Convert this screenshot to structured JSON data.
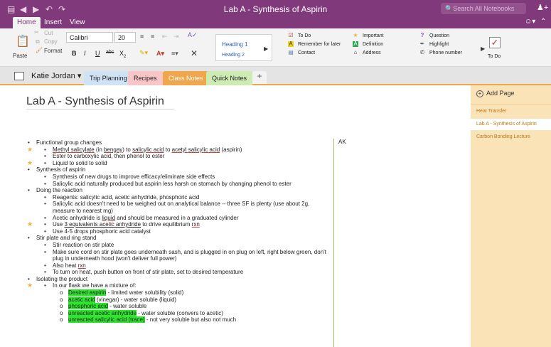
{
  "window": {
    "title": "Lab A - Synthesis of Aspirin",
    "search_placeholder": "Search All Notebooks"
  },
  "ribbon_tabs": [
    "Home",
    "Insert",
    "View"
  ],
  "ribbon": {
    "paste": "Paste",
    "cut": "Cut",
    "copy": "Copy",
    "format": "Format",
    "font_name": "Calibri",
    "font_size": "20",
    "bold": "B",
    "italic": "I",
    "underline": "U",
    "strikethrough": "abc",
    "subscript": "X",
    "styles": [
      "Heading 1",
      "Heading 2"
    ],
    "tags": [
      {
        "label": "To Do",
        "icon": "checkbox-icon",
        "color": "#c0392b"
      },
      {
        "label": "Remember for later",
        "icon": "highlight-a-icon",
        "color": "#f3d21a"
      },
      {
        "label": "Contact",
        "icon": "contact-icon",
        "color": "#5a7fb5"
      },
      {
        "label": "Important",
        "icon": "star-icon",
        "color": "#f0b23a"
      },
      {
        "label": "Definition",
        "icon": "definition-a-icon",
        "color": "#2ea44f"
      },
      {
        "label": "Address",
        "icon": "home-icon",
        "color": "#444444"
      },
      {
        "label": "Question",
        "icon": "question-icon",
        "color": "#8a4ec2"
      },
      {
        "label": "Highlight",
        "icon": "pen-icon",
        "color": "#555555"
      },
      {
        "label": "Phone number",
        "icon": "phone-icon",
        "color": "#444444"
      }
    ],
    "todo_button": "To Do"
  },
  "notebook": {
    "name": "Katie Jordan",
    "sections": [
      {
        "label": "Trip Planning",
        "color": "#cfe3f5"
      },
      {
        "label": "Recipes",
        "color": "#f8c6c6"
      },
      {
        "label": "Class Notes",
        "color": "#f0a64a",
        "active": true
      },
      {
        "label": "Quick Notes",
        "color": "#cdebb2"
      }
    ]
  },
  "page": {
    "title": "Lab A - Synthesis of Aspirin",
    "side_note": "AK",
    "n1": "Functional group changes",
    "n2a": "Methyl salicylate",
    "n2b": " (in ",
    "n2c": "bengay",
    "n2d": ") to ",
    "n2e": "salicylic acid",
    "n2f": " to ",
    "n2g": "acetyl salicylic acid",
    "n2h": " (aspirin)",
    "n3": "Ester to carboxylic acid, then phenol to ester",
    "n4": "Liquid to solid to solid",
    "n5": "Synthesis of aspirin",
    "n6": "Synthesis of new drugs to improve efficacy/eliminate side effects",
    "n7": "Salicylic acid naturally produced but aspirin less harsh on stomach by changing phenol to ester",
    "n8": "Doing the reaction",
    "n9": "Reagents: salicylic acid, acetic anhydride, phosphoric acid",
    "n10": "Salicylic acid doesn't need to be weighed out on analytical balance -- three SF is plenty (use about 2g, measure to nearest mg)",
    "n11a": "Acetic anhydride is ",
    "n11b": "liquid",
    "n11c": " and should be measured in a graduated cylinder",
    "n12a": "Use ",
    "n12b": "3 equivalents acetic anhydride",
    "n12c": " to drive equilibrium ",
    "n12d": "rxn",
    "n13": "Use 4-5 drops phosphoric acid catalyst",
    "n14": "Stir plate and ring stand",
    "n15": "Stir reaction on stir plate",
    "n16": "Make sure cord on stir plate goes underneath sash, and is plugged in on plug on left, right below green, don't plug in underneath hood (won't deliver full power)",
    "n17a": "Also heat ",
    "n17b": "rxn",
    "n18": "To turn on heat, push button on front of stir plate, set to desired temperature",
    "n19": "Isolating the product",
    "n20": "In our flask we have a mixture of:",
    "n21a": "Desired aspirin",
    "n21b": " - limited water solubility (solid)",
    "n22a": "acetic acid",
    "n22b": " (vinegar) - water soluble (liquid)",
    "n23a": "phosphoric acid",
    "n23b": " - water soluble",
    "n24a": "unreacted acetic anhydride",
    "n24b": " - water soluble (convers to acetic)",
    "n25a": "unreacted salicylic acid (trace)",
    "n25b": " - not very soluble but also not much"
  },
  "pages_pane": {
    "add_page": "Add Page",
    "pages": [
      "Heat Transfer",
      "Lab A - Synthesis of Aspirin",
      "Carbon Bonding Lecture"
    ]
  },
  "colors": {
    "title_bar": "#80397b",
    "section_accent": "#f0a64a",
    "highlight": "#2ee62e",
    "pane": "#fbe3b8"
  }
}
